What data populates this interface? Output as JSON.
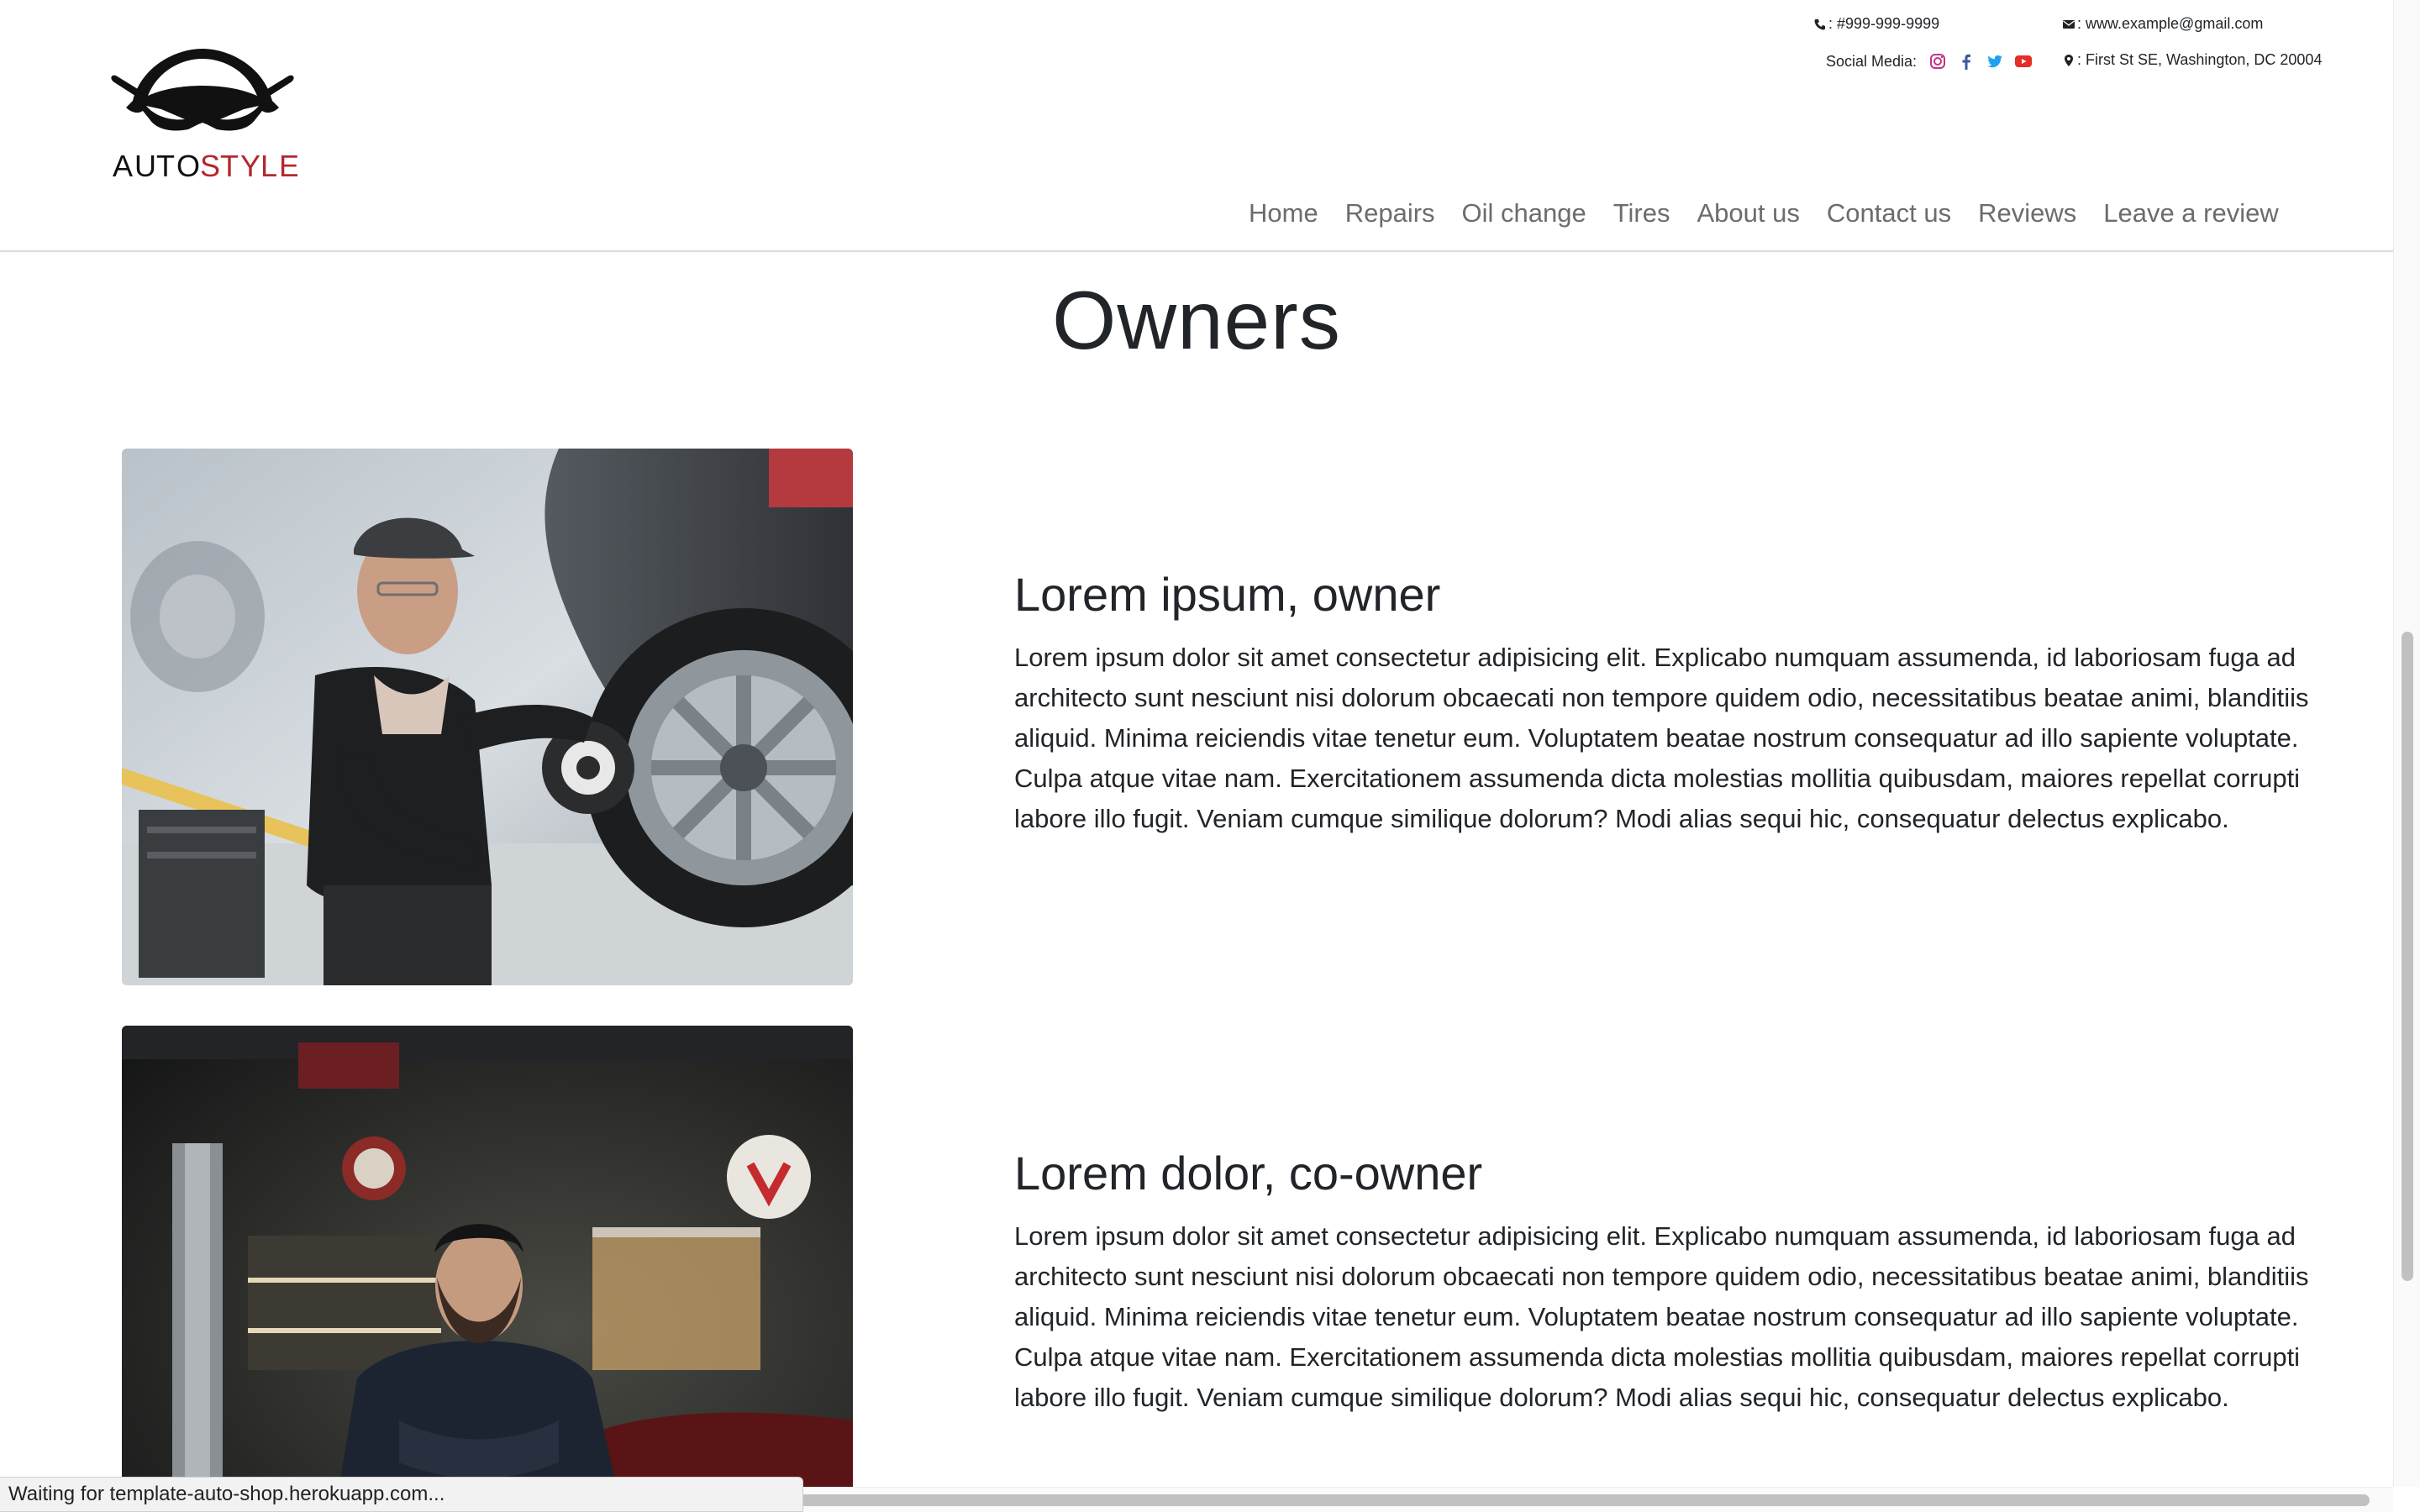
{
  "brand": {
    "logo_text_dark": "AUTO",
    "logo_text_accent": "STYLE",
    "accent_color": "#b3282d"
  },
  "contact": {
    "phone": ": #999-999-9999",
    "email": ": www.example@gmail.com",
    "address": ": First St SE, Washington, DC 20004",
    "social_label": "Social Media:",
    "social_icons": [
      "instagram-icon",
      "facebook-icon",
      "twitter-icon",
      "youtube-icon"
    ]
  },
  "nav": {
    "items": [
      {
        "label": "Home"
      },
      {
        "label": "Repairs"
      },
      {
        "label": "Oil change"
      },
      {
        "label": "Tires"
      },
      {
        "label": "About us"
      },
      {
        "label": "Contact us"
      },
      {
        "label": "Reviews"
      },
      {
        "label": "Leave a review"
      }
    ]
  },
  "main": {
    "title": "Owners",
    "people": [
      {
        "name": "Lorem ipsum, owner",
        "bio": "Lorem ipsum dolor sit amet consectetur adipisicing elit. Explicabo numquam assumenda, id laboriosam fuga ad architecto sunt nesciunt nisi dolorum obcaecati non tempore quidem odio, necessitatibus beatae animi, blanditiis aliquid. Minima reiciendis vitae tenetur eum. Voluptatem beatae nostrum consequatur ad illo sapiente voluptate. Culpa atque vitae nam. Exercitationem assumenda dicta molestias mollitia quibusdam, maiores repellat corrupti labore illo fugit. Veniam cumque similique dolorum? Modi alias sequi hic, consequatur delectus explicabo."
      },
      {
        "name": "Lorem dolor, co-owner",
        "bio": "Lorem ipsum dolor sit amet consectetur adipisicing elit. Explicabo numquam assumenda, id laboriosam fuga ad architecto sunt nesciunt nisi dolorum obcaecati non tempore quidem odio, necessitatibus beatae animi, blanditiis aliquid. Minima reiciendis vitae tenetur eum. Voluptatem beatae nostrum consequatur ad illo sapiente voluptate. Culpa atque vitae nam. Exercitationem assumenda dicta molestias mollitia quibusdam, maiores repellat corrupti labore illo fugit. Veniam cumque similique dolorum? Modi alias sequi hic, consequatur delectus explicabo."
      }
    ]
  },
  "status_bar": {
    "text": "Waiting for template-auto-shop.herokuapp.com..."
  }
}
